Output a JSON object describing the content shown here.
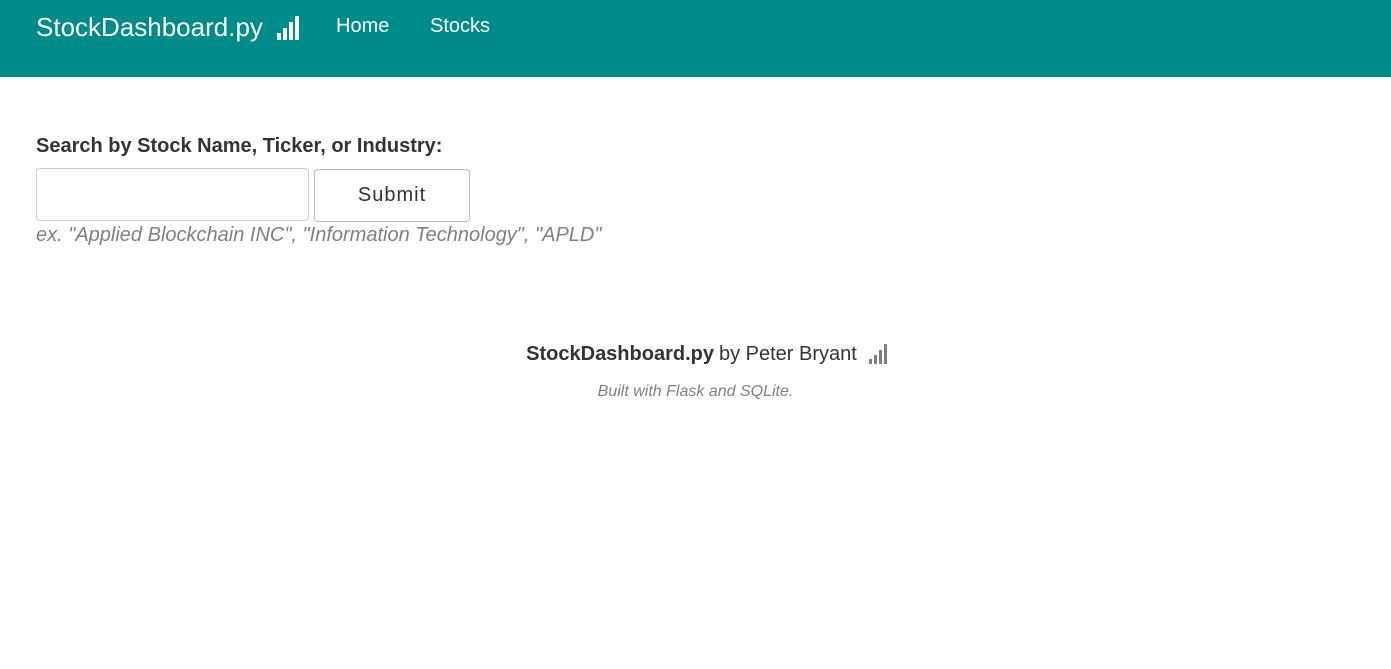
{
  "navbar": {
    "brand": "StockDashboard.py",
    "brand_icon": "signal-bars-icon",
    "links": [
      {
        "label": "Home"
      },
      {
        "label": "Stocks"
      }
    ],
    "background": "#008b8b"
  },
  "search": {
    "label": "Search by Stock Name, Ticker, or Industry:",
    "input_value": "",
    "submit_label": "Submit",
    "hint": "ex. \"Applied Blockchain INC\", \"Information Technology\", \"APLD\""
  },
  "footer": {
    "brand": "StockDashboard.py",
    "by_text": "by Peter Bryant",
    "icon": "signal-bars-icon",
    "built_with": "Built with Flask and SQLite."
  }
}
